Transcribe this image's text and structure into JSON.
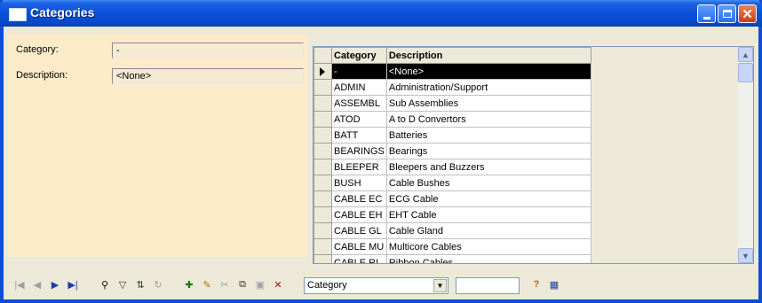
{
  "window": {
    "title": "Categories",
    "close_glyph": "✕",
    "icons": [
      "window-icon",
      "minimize-icon",
      "maximize-icon",
      "close-icon"
    ]
  },
  "form": {
    "category_label": "Category:",
    "category_value": "-",
    "description_label": "Description:",
    "description_value": "<None>"
  },
  "grid": {
    "columns": [
      "Category",
      "Description"
    ],
    "rows": [
      {
        "category": "-",
        "description": "<None>"
      },
      {
        "category": "ADMIN",
        "description": "Administration/Support"
      },
      {
        "category": "ASSEMBL",
        "description": "Sub Assemblies"
      },
      {
        "category": "ATOD",
        "description": "A to D Convertors"
      },
      {
        "category": "BATT",
        "description": "Batteries"
      },
      {
        "category": "BEARINGS",
        "description": "Bearings"
      },
      {
        "category": "BLEEPER",
        "description": "Bleepers and Buzzers"
      },
      {
        "category": "BUSH",
        "description": "Cable Bushes"
      },
      {
        "category": "CABLE EC",
        "description": "ECG Cable"
      },
      {
        "category": "CABLE EH",
        "description": "EHT Cable"
      },
      {
        "category": "CABLE GL",
        "description": "Cable Gland"
      },
      {
        "category": "CABLE MU",
        "description": "Multicore Cables"
      },
      {
        "category": "CABLE RI",
        "description": "Ribbon Cables"
      }
    ],
    "selected_row": 0
  },
  "toolbar": {
    "icons": [
      "first-record-icon",
      "prior-record-icon",
      "next-record-icon",
      "last-record-icon",
      "find-icon",
      "filter-icon",
      "sort-icon",
      "refresh-icon",
      "insert-icon",
      "edit-icon",
      "cut-icon",
      "copy-icon",
      "save-icon",
      "delete-icon",
      "help-icon",
      "grid-view-icon"
    ],
    "search_field_value": "Category",
    "search_text": ""
  },
  "colors": {
    "title_bar": "#0a4fd6",
    "form_background": "#fbebc9",
    "selected_row": "#000000"
  }
}
